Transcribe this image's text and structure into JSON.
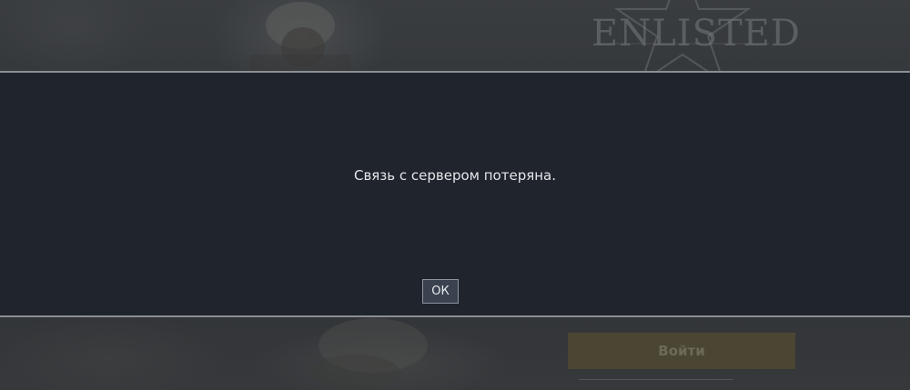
{
  "background": {
    "logo_text": "ENLISTED",
    "login_button_label": "Войти"
  },
  "dialog": {
    "message": "Связь с сервером потеряна.",
    "ok_label": "ОК"
  },
  "colors": {
    "modal_bg": "#1f242d",
    "modal_border": "#8b8f94",
    "button_bg": "#3a4250",
    "text": "#e4e6e8",
    "login_button_bg": "#4a4633"
  }
}
